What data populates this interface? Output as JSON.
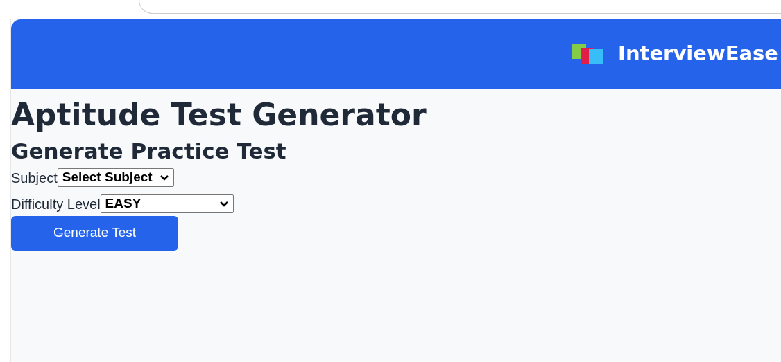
{
  "header": {
    "brand": "InterviewEase"
  },
  "page_title": "Aptitude Test Generator",
  "section_title": "Generate Practice Test",
  "fields": [
    {
      "label": "Subject",
      "value": "Select Subject"
    },
    {
      "label": "Difficulty Level",
      "value": "EASY"
    }
  ],
  "button": "Generate Test"
}
